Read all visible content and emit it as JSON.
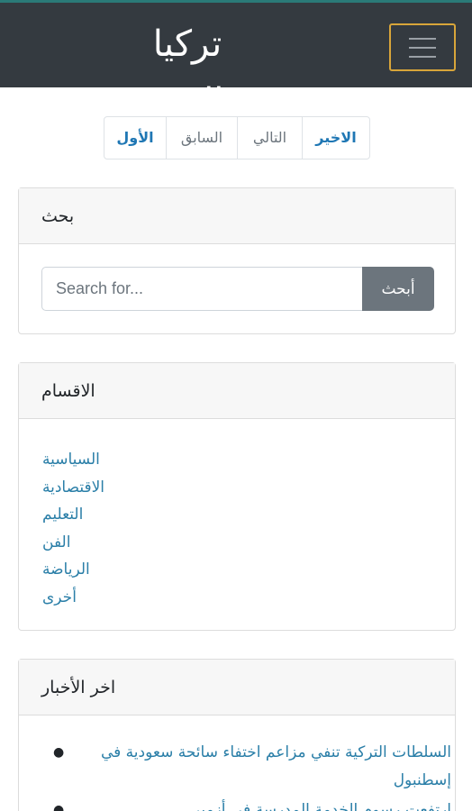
{
  "header": {
    "brand": "تركيا اليوم",
    "menu_icon": "hamburger-menu-icon"
  },
  "pagination": {
    "items": [
      {
        "label": "الاخير"
      },
      {
        "label": "التالي"
      },
      {
        "label": "السابق"
      },
      {
        "label": "الأول"
      }
    ]
  },
  "search_card": {
    "title": "بحث",
    "placeholder": "Search for...",
    "button_label": "أبحث"
  },
  "categories_card": {
    "title": "الاقسام",
    "items": [
      "السياسية",
      "الاقتصادية",
      "التعليم",
      "الفن",
      "الرياضة",
      "أخرى"
    ]
  },
  "news_card": {
    "title": "اخر الأخبار",
    "items": [
      "السلطات التركية تنفي مزاعم اختفاء سائحة سعودية في إسطنبول",
      "ارتفعت رسوم الخدمة المدرسة في أزمير"
    ]
  },
  "colors": {
    "navbar_bg": "#343a40",
    "toggler_border": "#d8a53a",
    "link": "#2b7fa8",
    "button_bg": "#6c757d"
  }
}
